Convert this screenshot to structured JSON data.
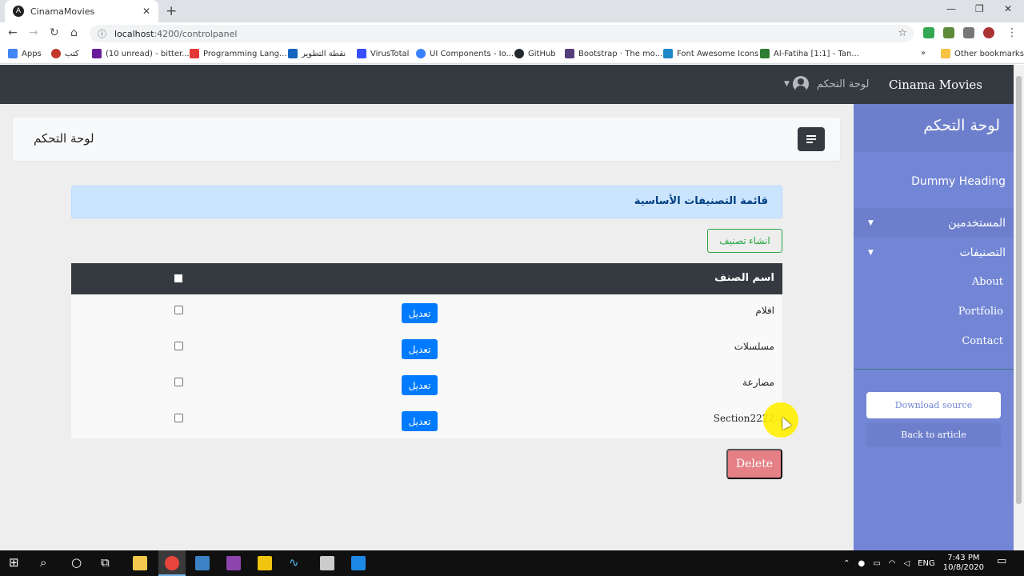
{
  "browser": {
    "tab_title": "CinamaMovies",
    "tab_favicon": "A",
    "url_host": "localhost",
    "url_path": ":4200/controlpanel",
    "bookmarks": [
      {
        "label": "Apps",
        "color": "#4285f4"
      },
      {
        "label": "كتب",
        "color": "#c0392b"
      },
      {
        "label": "(10 unread) - bitter...",
        "color": "#6a1b9a"
      },
      {
        "label": "Programming Lang...",
        "color": "#e53935"
      },
      {
        "label": "نقطة التطوير",
        "color": "#1565c0"
      },
      {
        "label": "VirusTotal",
        "color": "#394eff"
      },
      {
        "label": "UI Components - Io...",
        "color": "#3880ff"
      },
      {
        "label": "GitHub",
        "color": "#24292e"
      },
      {
        "label": "Bootstrap · The mo...",
        "color": "#563d7c"
      },
      {
        "label": "Font Awesome Icons",
        "color": "#1c88c7"
      },
      {
        "label": "Al-Fatiha [1:1] - Tan...",
        "color": "#2e7d32"
      }
    ],
    "bookmarks_overflow": "»",
    "other_bookmarks": "Other bookmarks"
  },
  "navbar": {
    "brand": "Cinama Movies",
    "user_link": "لوحة التحكم"
  },
  "sidebar": {
    "header": "لوحة التحكم",
    "dummy_heading": "Dummy Heading",
    "items": [
      {
        "label": "المستخدمين",
        "dropdown": true
      },
      {
        "label": "التصنيفات",
        "dropdown": true
      }
    ],
    "links": [
      "About",
      "Portfolio",
      "Contact"
    ],
    "download_label": "Download source",
    "back_label": "Back to article"
  },
  "content": {
    "card_title": "لوحة التحكم",
    "alert_text": "قائمة التصنيفات الأساسية",
    "create_button": "انشاء تصنيف",
    "table": {
      "header_name": "اسم الصنف",
      "rows": [
        {
          "name": "افلام",
          "edit": "تعديل"
        },
        {
          "name": "مسلسلات",
          "edit": "تعديل"
        },
        {
          "name": "مصارعة",
          "edit": "تعديل"
        },
        {
          "name": "Section2222",
          "edit": "تعديل"
        }
      ]
    },
    "delete_button": "Delete"
  },
  "taskbar": {
    "language": "ENG",
    "time": "7:43 PM",
    "date": "10/8/2020"
  },
  "colors": {
    "navbar": "#343a40",
    "sidebar": "#7386d5",
    "sidebar_active": "#6d7fcc",
    "primary": "#007bff",
    "success": "#28a745",
    "danger_disabled": "#e58086",
    "alert_bg": "#cce5ff"
  }
}
